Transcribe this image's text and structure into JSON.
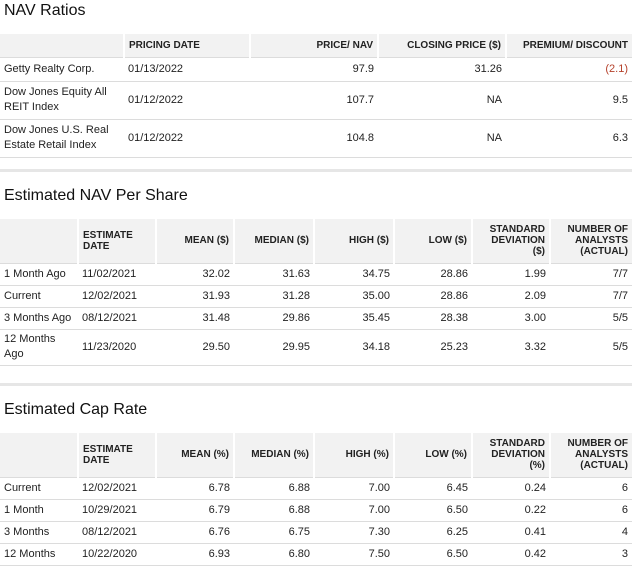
{
  "nav_ratios": {
    "title": "NAV Ratios",
    "headers": [
      "",
      "PRICING DATE",
      "PRICE/ NAV",
      "CLOSING PRICE ($)",
      "PREMIUM/ DISCOUNT"
    ],
    "rows": [
      {
        "name": "Getty Realty Corp.",
        "date": "01/13/2022",
        "price_nav": "97.9",
        "closing": "31.26",
        "premium": "(2.1)"
      },
      {
        "name": "Dow Jones Equity All REIT Index",
        "date": "01/12/2022",
        "price_nav": "107.7",
        "closing": "NA",
        "premium": "9.5"
      },
      {
        "name": "Dow Jones U.S. Real Estate Retail Index",
        "date": "01/12/2022",
        "price_nav": "104.8",
        "closing": "NA",
        "premium": "6.3"
      }
    ]
  },
  "nav_per_share": {
    "title": "Estimated NAV Per Share",
    "headers": [
      "",
      "ESTIMATE DATE",
      "MEAN ($)",
      "MEDIAN ($)",
      "HIGH ($)",
      "LOW ($)",
      "STANDARD DEVIATION ($)",
      "NUMBER OF ANALYSTS (ACTUAL)"
    ],
    "rows": [
      {
        "period": "1 Month Ago",
        "date": "11/02/2021",
        "mean": "32.02",
        "median": "31.63",
        "high": "34.75",
        "low": "28.86",
        "std": "1.99",
        "analysts": "7/7"
      },
      {
        "period": "Current",
        "date": "12/02/2021",
        "mean": "31.93",
        "median": "31.28",
        "high": "35.00",
        "low": "28.86",
        "std": "2.09",
        "analysts": "7/7"
      },
      {
        "period": "3 Months Ago",
        "date": "08/12/2021",
        "mean": "31.48",
        "median": "29.86",
        "high": "35.45",
        "low": "28.38",
        "std": "3.00",
        "analysts": "5/5"
      },
      {
        "period": "12 Months Ago",
        "date": "11/23/2020",
        "mean": "29.50",
        "median": "29.95",
        "high": "34.18",
        "low": "25.23",
        "std": "3.32",
        "analysts": "5/5"
      }
    ]
  },
  "cap_rate": {
    "title": "Estimated Cap Rate",
    "headers": [
      "",
      "ESTIMATE DATE",
      "MEAN (%)",
      "MEDIAN (%)",
      "HIGH (%)",
      "LOW (%)",
      "STANDARD DEVIATION (%)",
      "NUMBER OF ANALYSTS (ACTUAL)"
    ],
    "rows": [
      {
        "period": "Current",
        "date": "12/02/2021",
        "mean": "6.78",
        "median": "6.88",
        "high": "7.00",
        "low": "6.45",
        "std": "0.24",
        "analysts": "6"
      },
      {
        "period": "1 Month",
        "date": "10/29/2021",
        "mean": "6.79",
        "median": "6.88",
        "high": "7.00",
        "low": "6.50",
        "std": "0.22",
        "analysts": "6"
      },
      {
        "period": "3 Months",
        "date": "08/12/2021",
        "mean": "6.76",
        "median": "6.75",
        "high": "7.30",
        "low": "6.25",
        "std": "0.41",
        "analysts": "4"
      },
      {
        "period": "12 Months",
        "date": "10/22/2020",
        "mean": "6.93",
        "median": "6.80",
        "high": "7.50",
        "low": "6.50",
        "std": "0.42",
        "analysts": "3"
      }
    ]
  }
}
